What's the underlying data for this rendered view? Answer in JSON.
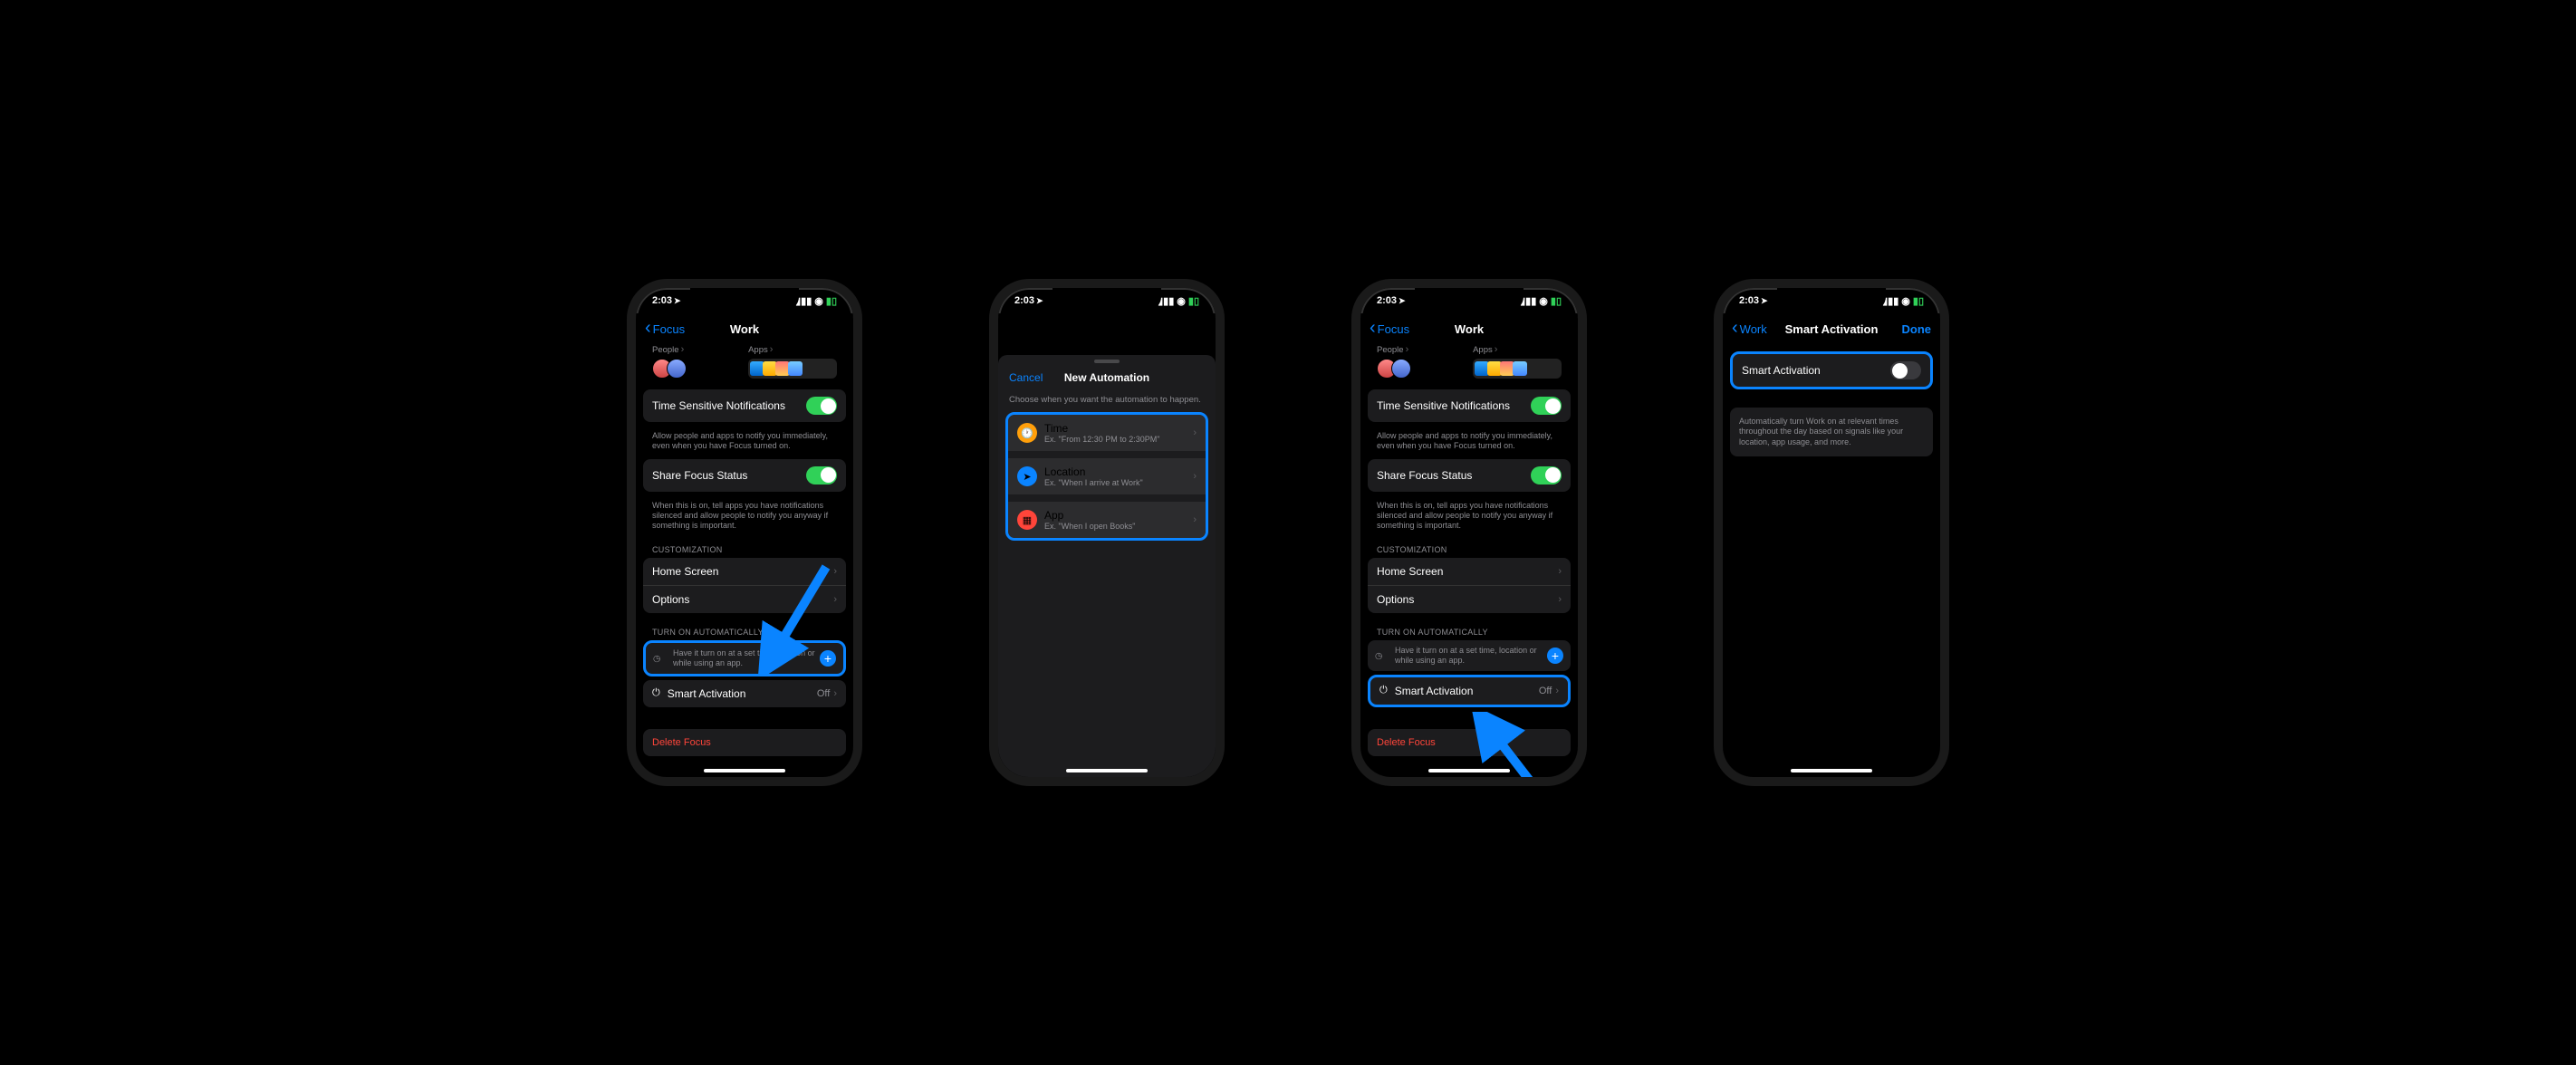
{
  "status": {
    "time": "2:03",
    "loc_arrow": "➤"
  },
  "phone1": {
    "back": "Focus",
    "title": "Work",
    "people_label": "People",
    "apps_label": "Apps",
    "time_sensitive": "Time Sensitive Notifications",
    "time_sensitive_note": "Allow people and apps to notify you immediately, even when you have Focus turned on.",
    "share_status": "Share Focus Status",
    "share_status_note": "When this is on, tell apps you have notifications silenced and allow people to notify you anyway if something is important.",
    "customization": "CUSTOMIZATION",
    "home_screen": "Home Screen",
    "options": "Options",
    "turn_on_auto": "TURN ON AUTOMATICALLY",
    "auto_hint": "Have it turn on at a set time, location or while using an app.",
    "smart_activation": "Smart Activation",
    "smart_value": "Off",
    "delete": "Delete Focus"
  },
  "phone2": {
    "cancel": "Cancel",
    "title": "New Automation",
    "hint": "Choose when you want the automation to happen.",
    "time_label": "Time",
    "time_ex": "Ex. \"From 12:30 PM to 2:30PM\"",
    "location_label": "Location",
    "location_ex": "Ex. \"When I arrive at Work\"",
    "app_label": "App",
    "app_ex": "Ex. \"When I open Books\""
  },
  "phone3": {
    "back": "Focus",
    "title": "Work",
    "smart_activation": "Smart Activation",
    "smart_value": "Off"
  },
  "phone4": {
    "back": "Work",
    "title": "Smart Activation",
    "done": "Done",
    "row_label": "Smart Activation",
    "note": "Automatically turn Work on at relevant times throughout the day based on signals like your location, app usage, and more."
  }
}
